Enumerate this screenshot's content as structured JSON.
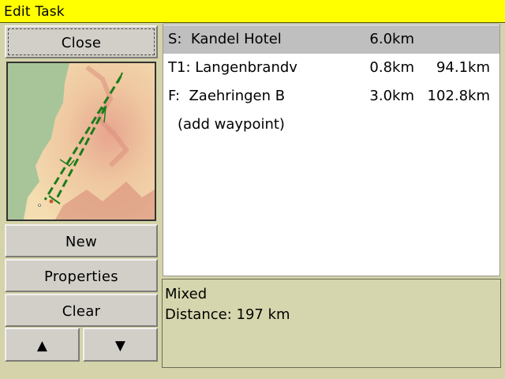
{
  "window": {
    "title": "Edit Task"
  },
  "buttons": {
    "close": "Close",
    "new": "New",
    "properties": "Properties",
    "clear": "Clear",
    "up": "▲",
    "down": "▼"
  },
  "task": {
    "points": [
      {
        "name": "S:  Kandel Hotel",
        "leg": "6.0km",
        "total": ""
      },
      {
        "name": "T1: Langenbrandv",
        "leg": "0.8km",
        "total": "94.1km"
      },
      {
        "name": "F:  Zaehringen B",
        "leg": "3.0km",
        "total": "102.8km"
      }
    ],
    "add_waypoint": "(add waypoint)",
    "type": "Mixed",
    "distance": "Distance: 197 km"
  },
  "colors": {
    "title_bar": "#ffff00",
    "panel_bg": "#d4d3aa",
    "selected_row": "#bfbfbf",
    "task_line": "#1a7d1a"
  },
  "icons": {
    "up": "triangle-up-icon",
    "down": "triangle-down-icon"
  }
}
